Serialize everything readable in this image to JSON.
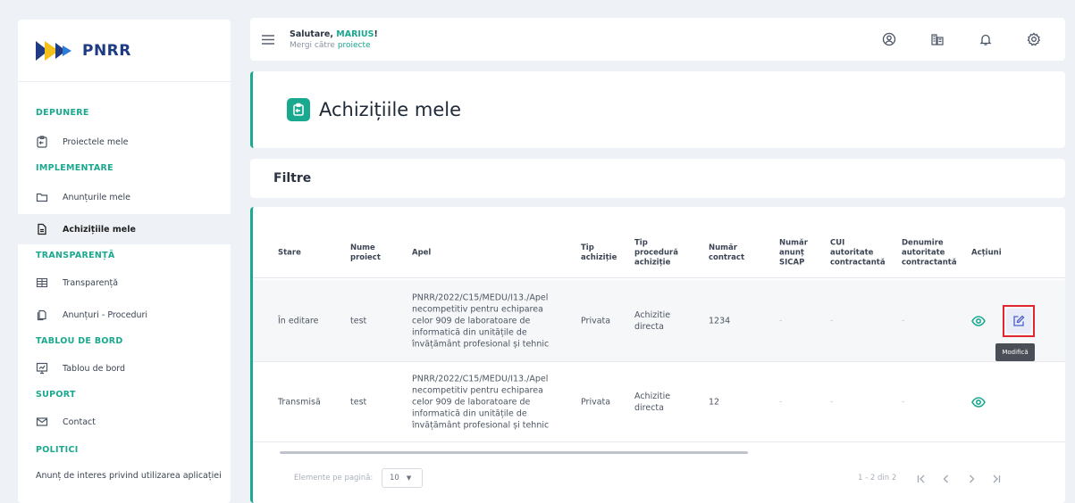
{
  "brand": {
    "name": "PNRR"
  },
  "sidebar": {
    "sections": [
      {
        "label": "DEPUNERE",
        "items": [
          {
            "label": "Proiectele mele",
            "icon": "clipboard-icon"
          }
        ]
      },
      {
        "label": "IMPLEMENTARE",
        "items": [
          {
            "label": "Anunțurile mele",
            "icon": "folder-icon"
          },
          {
            "label": "Achizițiile mele",
            "icon": "document-icon",
            "active": true
          }
        ]
      },
      {
        "label": "TRANSPARENȚĂ",
        "items": [
          {
            "label": "Transparență",
            "icon": "table-icon"
          },
          {
            "label": "Anunțuri - Proceduri",
            "icon": "file-stack-icon"
          }
        ]
      },
      {
        "label": "TABLOU DE BORD",
        "items": [
          {
            "label": "Tablou de bord",
            "icon": "dashboard-icon"
          }
        ]
      },
      {
        "label": "SUPORT",
        "items": [
          {
            "label": "Contact",
            "icon": "mail-icon"
          }
        ]
      },
      {
        "label": "POLITICI",
        "items": []
      }
    ],
    "footer_link": "Anunț de interes privind utilizarea aplicației"
  },
  "topbar": {
    "greeting_prefix": "Salutare,",
    "user_name": "MARIUS",
    "greeting_suffix": "!",
    "sub_prefix": "Mergi către",
    "sub_link": "proiecte",
    "icons": [
      "user-circle-icon",
      "building-icon",
      "bell-icon",
      "settings-icon"
    ]
  },
  "page": {
    "title": "Achizițiile mele"
  },
  "filters": {
    "title": "Filtre"
  },
  "table": {
    "columns": {
      "stare": "Stare",
      "nume_proiect": "Nume proiect",
      "apel": "Apel",
      "tip_achizitie": "Tip achiziție",
      "tip_procedura": "Tip procedură achiziție",
      "numar_contract": "Număr contract",
      "numar_anunt": "Număr anunț SICAP",
      "cui": "CUI autoritate contractantă",
      "denumire": "Denumire autoritate contractantă",
      "actiuni": "Acțiuni"
    },
    "rows": [
      {
        "stare": "În editare",
        "nume_proiect": "test",
        "apel": "PNRR/2022/C15/MEDU/I13./Apel necompetitiv pentru echiparea celor 909 de laboratoare de informatică din unitățile de învățământ profesional și tehnic",
        "tip_achizitie": "Privata",
        "tip_procedura": "Achizitie directa",
        "numar_contract": "1234",
        "numar_anunt": "-",
        "cui": "-",
        "denumire": "-"
      },
      {
        "stare": "Transmisă",
        "nume_proiect": "test",
        "apel": "PNRR/2022/C15/MEDU/I13./Apel necompetitiv pentru echiparea celor 909 de laboratoare de informatică din unitățile de învățământ profesional și tehnic",
        "tip_achizitie": "Privata",
        "tip_procedura": "Achizitie directa",
        "numar_contract": "12",
        "numar_anunt": "-",
        "cui": "-",
        "denumire": "-"
      }
    ],
    "tooltip": "Modifică"
  },
  "pagination": {
    "per_page_label": "Elemente pe pagină:",
    "per_page_value": "10",
    "range": "1 - 2 din 2"
  },
  "colors": {
    "accent": "#1aa88f",
    "brand_blue": "#1f3b83",
    "highlight_red": "#e0262e"
  }
}
